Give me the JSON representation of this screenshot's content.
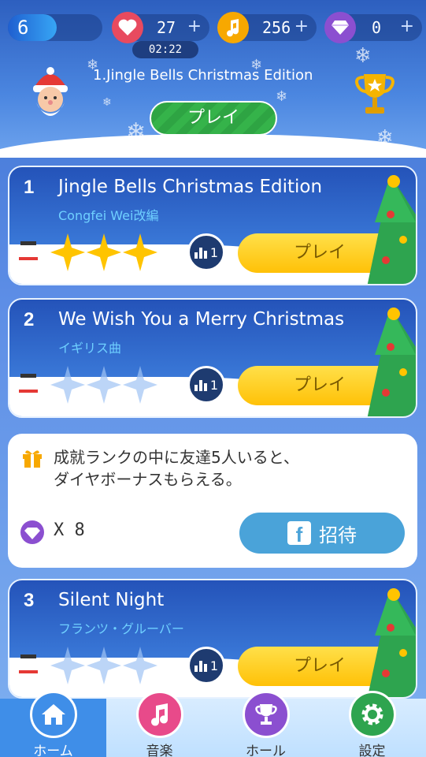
{
  "status_bar": {
    "level": "6",
    "lives": "27",
    "lives_timer": "02:22",
    "notes": "256",
    "diamonds": "0",
    "plus": "+"
  },
  "header": {
    "now_playing": "1.Jingle Bells Christmas Edition",
    "play_label": "プレイ"
  },
  "songs": [
    {
      "number": "1",
      "title": "Jingle Bells Christmas Edition",
      "artist": "Congfei Wei改編",
      "stars": 3,
      "rank": "1",
      "play_label": "プレイ"
    },
    {
      "number": "2",
      "title": "We Wish You a Merry Christmas",
      "artist": "イギリス曲",
      "stars": 0,
      "rank": "1",
      "play_label": "プレイ"
    },
    {
      "number": "3",
      "title": "Silent Night",
      "artist": "フランツ・グルーバー",
      "stars": 0,
      "rank": "1",
      "play_label": "プレイ"
    }
  ],
  "invite": {
    "message_line1": "成就ランクの中に友達5人いると、",
    "message_line2": "ダイヤボーナスもらえる。",
    "reward_count": "X 8",
    "button_label": "招待",
    "fb_letter": "f"
  },
  "nav": {
    "home": "ホーム",
    "music": "音楽",
    "hall": "ホール",
    "settings": "設定"
  },
  "colors": {
    "accent_yellow": "#ffc107",
    "play_green": "#35b34a",
    "lives_red": "#e84a5f",
    "notes_orange": "#f7a800",
    "diamond_purple": "#8b4fd0"
  }
}
